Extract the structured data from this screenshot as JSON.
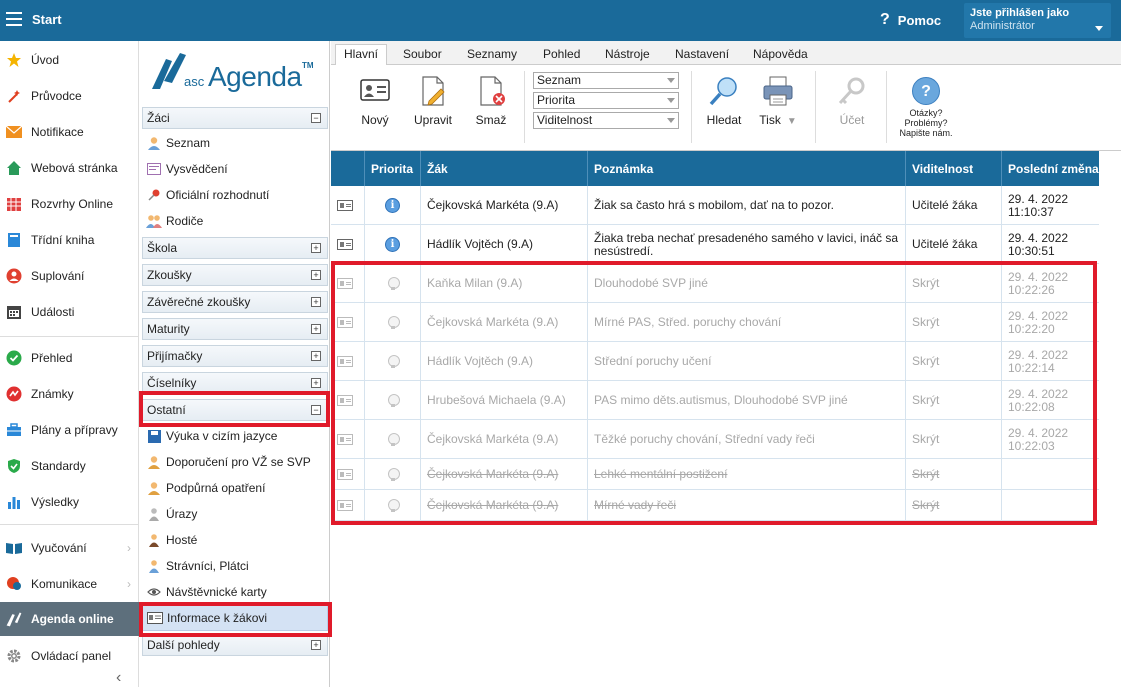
{
  "topbar": {
    "start_label": "Start",
    "help_label": "Pomoc",
    "user_line1": "Jste přihlášen jako",
    "user_line2": "Administrátor"
  },
  "leftnav": {
    "items": [
      {
        "label": "Úvod",
        "icon": "star-icon",
        "color": "#f5b400"
      },
      {
        "label": "Průvodce",
        "icon": "wand-icon",
        "color": "#e04020"
      },
      {
        "label": "Notifikace",
        "icon": "mail-icon",
        "color": "#f09020"
      },
      {
        "label": "Webová stránka",
        "icon": "house-icon",
        "color": "#2a9a5a"
      },
      {
        "label": "Rozvrhy Online",
        "icon": "calendar-grid-icon",
        "color": "#e04040"
      },
      {
        "label": "Třídní kniha",
        "icon": "book-icon",
        "color": "#2a88d8"
      },
      {
        "label": "Suplování",
        "icon": "person-icon",
        "color": "#e04030"
      },
      {
        "label": "Události",
        "icon": "calendar-icon",
        "color": "#444444"
      },
      {
        "label": "Přehled",
        "icon": "check-icon",
        "color": "#2aaa4a"
      },
      {
        "label": "Známky",
        "icon": "grade-icon",
        "color": "#e03030"
      },
      {
        "label": "Plány a přípravy",
        "icon": "briefcase-icon",
        "color": "#2a88d8"
      },
      {
        "label": "Standardy",
        "icon": "shield-icon",
        "color": "#2aaa4a"
      },
      {
        "label": "Výsledky",
        "icon": "bar-chart-icon",
        "color": "#2a88d8"
      },
      {
        "label": "Vyučování",
        "icon": "book-open-icon",
        "color": "#1a6a9a"
      },
      {
        "label": "Komunikace",
        "icon": "chat-icon",
        "color": "#e04020"
      },
      {
        "label": "Agenda online",
        "icon": "pen-icon",
        "color": "#ffffff"
      },
      {
        "label": "Ovládací panel",
        "icon": "gear-icon",
        "color": "#888888"
      }
    ],
    "collapse_glyph": "‹"
  },
  "midpanel": {
    "logo_asc": "asc",
    "logo_agenda": "Agenda",
    "logo_tm": "TM",
    "sections": [
      {
        "label": "Žáci",
        "state": "−"
      },
      {
        "label": "Škola",
        "state": "+"
      },
      {
        "label": "Zkoušky",
        "state": "+"
      },
      {
        "label": "Závěrečné zkoušky",
        "state": "+"
      },
      {
        "label": "Maturity",
        "state": "+"
      },
      {
        "label": "Přijímačky",
        "state": "+"
      },
      {
        "label": "Číselníky",
        "state": "+"
      },
      {
        "label": "Ostatní",
        "state": "−"
      },
      {
        "label": "Další pohledy",
        "state": "+"
      }
    ],
    "zaci_items": [
      "Seznam",
      "Vysvědčení",
      "Oficiální rozhodnutí",
      "Rodiče"
    ],
    "ostatni_items": [
      "Výuka v cizím jazyce",
      "Doporučení pro VŽ se SVP",
      "Podpůrná opatření",
      "Úrazy",
      "Hosté",
      "Strávníci, Plátci",
      "Návštěvnické karty",
      "Informace k žákovi"
    ]
  },
  "tabs": [
    "Hlavní",
    "Soubor",
    "Seznamy",
    "Pohled",
    "Nástroje",
    "Nastavení",
    "Nápověda"
  ],
  "toolbar": {
    "new_label": "Nový",
    "edit_label": "Upravit",
    "delete_label": "Smaž",
    "select_1": "Seznam",
    "select_2": "Priorita",
    "select_3": "Viditelnost",
    "search_label": "Hledat",
    "print_label": "Tisk",
    "account_label": "Účet",
    "help_q": "?",
    "help_line1": "Otázky?",
    "help_line2": "Problémy?",
    "help_line3": "Napište nám."
  },
  "table": {
    "headers": [
      "",
      "Priorita",
      "Žák",
      "Poznámka",
      "Viditelnost",
      "Poslední změna"
    ],
    "rows": [
      {
        "priority": "info",
        "student": "Čejkovská Markéta (9.A)",
        "note": "Žiak sa často hrá s mobilom, dať na to pozor.",
        "visibility": "Učitelé žáka",
        "date": "29. 4. 2022",
        "time": "11:10:37",
        "style": "normal"
      },
      {
        "priority": "info",
        "student": "Hádlík Vojtěch (9.A)",
        "note": "Žiaka treba nechať presadeného samého v lavici, ináč sa nesústredí.",
        "visibility": "Učitelé žáka",
        "date": "29. 4. 2022",
        "time": "10:30:51",
        "style": "normal"
      },
      {
        "priority": "bulb",
        "student": "Kaňka Milan (9.A)",
        "note": "Dlouhodobé SVP jiné",
        "visibility": "Skrýt",
        "date": "29. 4. 2022",
        "time": "10:22:26",
        "style": "faded"
      },
      {
        "priority": "bulb",
        "student": "Čejkovská Markéta (9.A)",
        "note": "Mírné PAS, Střed. poruchy chování",
        "visibility": "Skrýt",
        "date": "29. 4. 2022",
        "time": "10:22:20",
        "style": "faded"
      },
      {
        "priority": "bulb",
        "student": "Hádlík Vojtěch (9.A)",
        "note": "Střední poruchy učení",
        "visibility": "Skrýt",
        "date": "29. 4. 2022",
        "time": "10:22:14",
        "style": "faded"
      },
      {
        "priority": "bulb",
        "student": "Hrubešová Michaela (9.A)",
        "note": "PAS mimo děts.autismus, Dlouhodobé SVP jiné",
        "visibility": "Skrýt",
        "date": "29. 4. 2022",
        "time": "10:22:08",
        "style": "faded"
      },
      {
        "priority": "bulb",
        "student": "Čejkovská Markéta (9.A)",
        "note": "Těžké poruchy chování, Střední vady řeči",
        "visibility": "Skrýt",
        "date": "29. 4. 2022",
        "time": "10:22:03",
        "style": "faded"
      },
      {
        "priority": "bulb",
        "student": "Čejkovská Markéta (9.A)",
        "note": "Lehké mentální postižení",
        "visibility": "Skrýt",
        "date": "",
        "time": "",
        "style": "strike"
      },
      {
        "priority": "bulb",
        "student": "Čejkovská Markéta (9.A)",
        "note": "Mírné vady řeči",
        "visibility": "Skrýt",
        "date": "",
        "time": "",
        "style": "strike"
      }
    ]
  },
  "colors": {
    "brand": "#1a6a9a",
    "highlight_red": "#e01a2a"
  }
}
